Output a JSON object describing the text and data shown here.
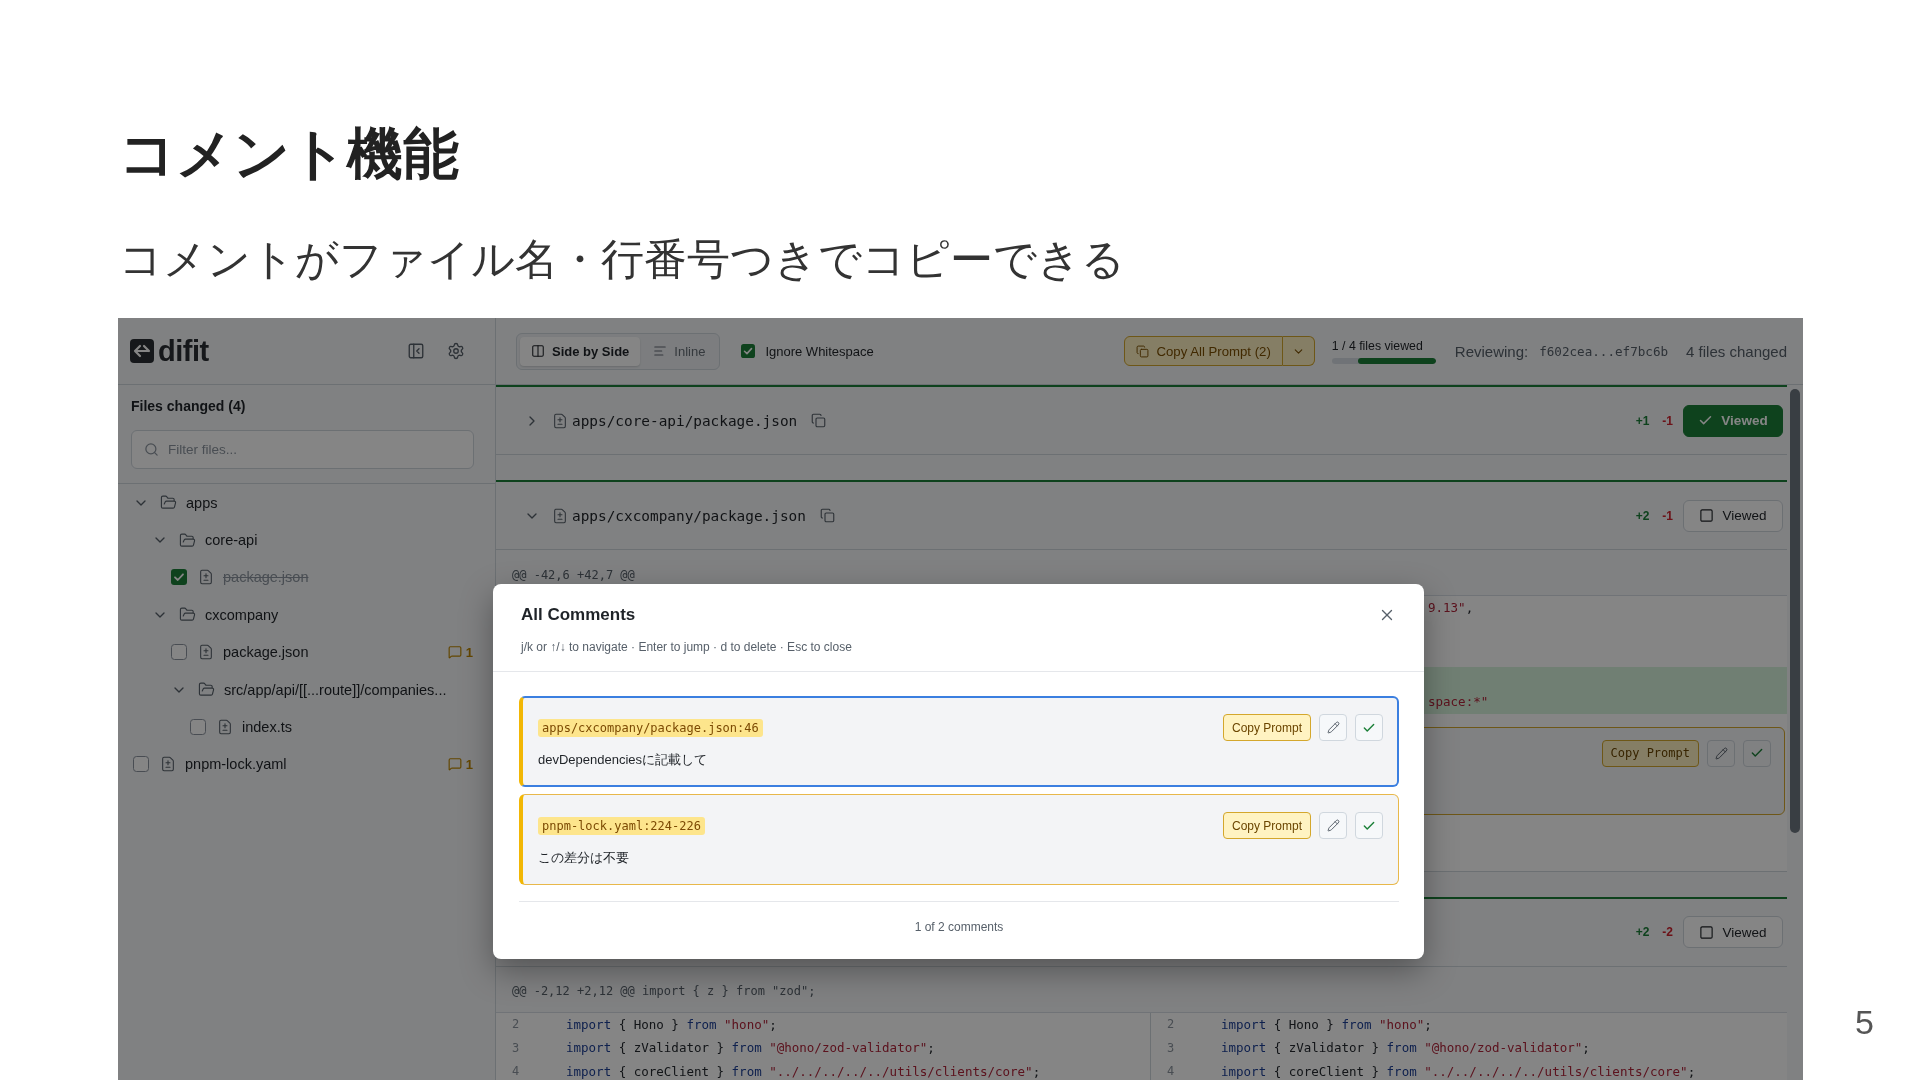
{
  "slide": {
    "title": "コメント機能",
    "subtitle": "コメントがファイル名・行番号つきでコピーできる",
    "page_number": "5"
  },
  "header": {
    "logo": "difit",
    "view_modes": [
      {
        "kind": "columns",
        "label": "Side by Side",
        "selected": true
      },
      {
        "kind": "lines",
        "label": "Inline",
        "selected": false
      }
    ],
    "ignore_whitespace": {
      "label": "Ignore Whitespace",
      "checked": true
    },
    "copy_all": {
      "label": "Copy All Prompt (2)"
    },
    "progress": {
      "label": "1 / 4 files viewed",
      "level": 0.75
    },
    "reviewing": {
      "label": "Reviewing:",
      "commits": "f602cea...ef7bc6b"
    },
    "files_changed": "4 files changed"
  },
  "sidebar": {
    "title": "Files changed (4)",
    "filter": {
      "placeholder": "Filter files..."
    },
    "tree": [
      {
        "kind": "folder",
        "name": "apps",
        "expanded": true,
        "children": [
          {
            "kind": "folder",
            "name": "core-api",
            "expanded": true,
            "children": [
              {
                "kind": "file",
                "name": "package.json",
                "checked": true
              }
            ]
          },
          {
            "kind": "folder",
            "name": "cxcompany",
            "expanded": true,
            "children": [
              {
                "kind": "file",
                "name": "package.json",
                "checked": false,
                "comments": "1"
              },
              {
                "kind": "folder",
                "name": "src/app/api/[[...route]]/companies...",
                "expanded": true,
                "children": [
                  {
                    "kind": "file",
                    "name": "index.ts",
                    "checked": false
                  }
                ]
              }
            ]
          }
        ]
      },
      {
        "kind": "file",
        "name": "pnpm-lock.yaml",
        "checked": false,
        "comments": "1"
      }
    ]
  },
  "diff": {
    "files": [
      {
        "path": "apps/core-api/package.json",
        "expanded": false,
        "additions": "+1",
        "deletions": "-1",
        "viewed": true,
        "viewed_label": "Viewed"
      },
      {
        "path": "apps/cxcompany/package.json",
        "expanded": true,
        "additions": "+2",
        "deletions": "-1",
        "viewed": false,
        "viewed_label": "Viewed",
        "hunk": "@@ -42,6 +42,7 @@",
        "rows": [
          {
            "kind": "context",
            "partial_code": [
              {
                "kind": "string",
                "text": "9.13\""
              },
              {
                "kind": "plain",
                "text": ","
              }
            ]
          },
          {
            "kind": "context"
          },
          {
            "kind": "context"
          },
          {
            "kind": "added"
          },
          {
            "kind": "added",
            "partial_code": [
              {
                "kind": "string",
                "text": "space:*\""
              }
            ]
          },
          {
            "kind": "comment",
            "copy_label": "Copy Prompt"
          },
          {
            "kind": "context"
          },
          {
            "kind": "context"
          }
        ]
      },
      {
        "additions": "+2",
        "deletions": "-2",
        "viewed": false,
        "viewed_label": "Viewed",
        "hunk": "@@ -2,12 +2,12 @@ import { z } from \"zod\";",
        "rows": [
          {
            "kind": "context",
            "left_number": "2",
            "left_code": [
              {
                "kind": "keyword",
                "text": "import"
              },
              {
                "kind": "plain",
                "text": " { Hono } "
              },
              {
                "kind": "keyword",
                "text": "from"
              },
              {
                "kind": "string",
                "text": " \"hono\""
              },
              {
                "kind": "plain",
                "text": ";"
              }
            ],
            "right_number": "2",
            "right_code": [
              {
                "kind": "keyword",
                "text": "import"
              },
              {
                "kind": "plain",
                "text": " { Hono } "
              },
              {
                "kind": "keyword",
                "text": "from"
              },
              {
                "kind": "string",
                "text": " \"hono\""
              },
              {
                "kind": "plain",
                "text": ";"
              }
            ]
          },
          {
            "kind": "context",
            "left_number": "3",
            "left_code": [
              {
                "kind": "keyword",
                "text": "import"
              },
              {
                "kind": "plain",
                "text": " { zValidator } "
              },
              {
                "kind": "keyword",
                "text": "from"
              },
              {
                "kind": "string",
                "text": " \"@hono/zod-validator\""
              },
              {
                "kind": "plain",
                "text": ";"
              }
            ],
            "right_number": "3",
            "right_code": [
              {
                "kind": "keyword",
                "text": "import"
              },
              {
                "kind": "plain",
                "text": " { zValidator } "
              },
              {
                "kind": "keyword",
                "text": "from"
              },
              {
                "kind": "string",
                "text": " \"@hono/zod-validator\""
              },
              {
                "kind": "plain",
                "text": ";"
              }
            ]
          },
          {
            "kind": "context",
            "left_number": "4",
            "left_code": [
              {
                "kind": "keyword",
                "text": "import"
              },
              {
                "kind": "plain",
                "text": " { coreClient } "
              },
              {
                "kind": "keyword",
                "text": "from"
              },
              {
                "kind": "string",
                "text": " \"../../../../../utils/clients/core\""
              },
              {
                "kind": "plain",
                "text": ";"
              }
            ],
            "right_number": "4",
            "right_code": [
              {
                "kind": "keyword",
                "text": "import"
              },
              {
                "kind": "plain",
                "text": " { coreClient } "
              },
              {
                "kind": "keyword",
                "text": "from"
              },
              {
                "kind": "string",
                "text": " \"../../../../../utils/clients/core\""
              },
              {
                "kind": "plain",
                "text": ";"
              }
            ]
          }
        ]
      }
    ]
  },
  "modal": {
    "title": "All Comments",
    "hint": "j/k or ↑/↓ to navigate · Enter to jump · d to delete · Esc to close",
    "comments": [
      {
        "location": "apps/cxcompany/package.json:46",
        "body": "devDependenciesに記載して",
        "copy_label": "Copy Prompt",
        "selected": true
      },
      {
        "location": "pnpm-lock.yaml:224-226",
        "body": "この差分は不要",
        "copy_label": "Copy Prompt",
        "selected": false
      }
    ],
    "footer": "1 of 2 comments"
  }
}
